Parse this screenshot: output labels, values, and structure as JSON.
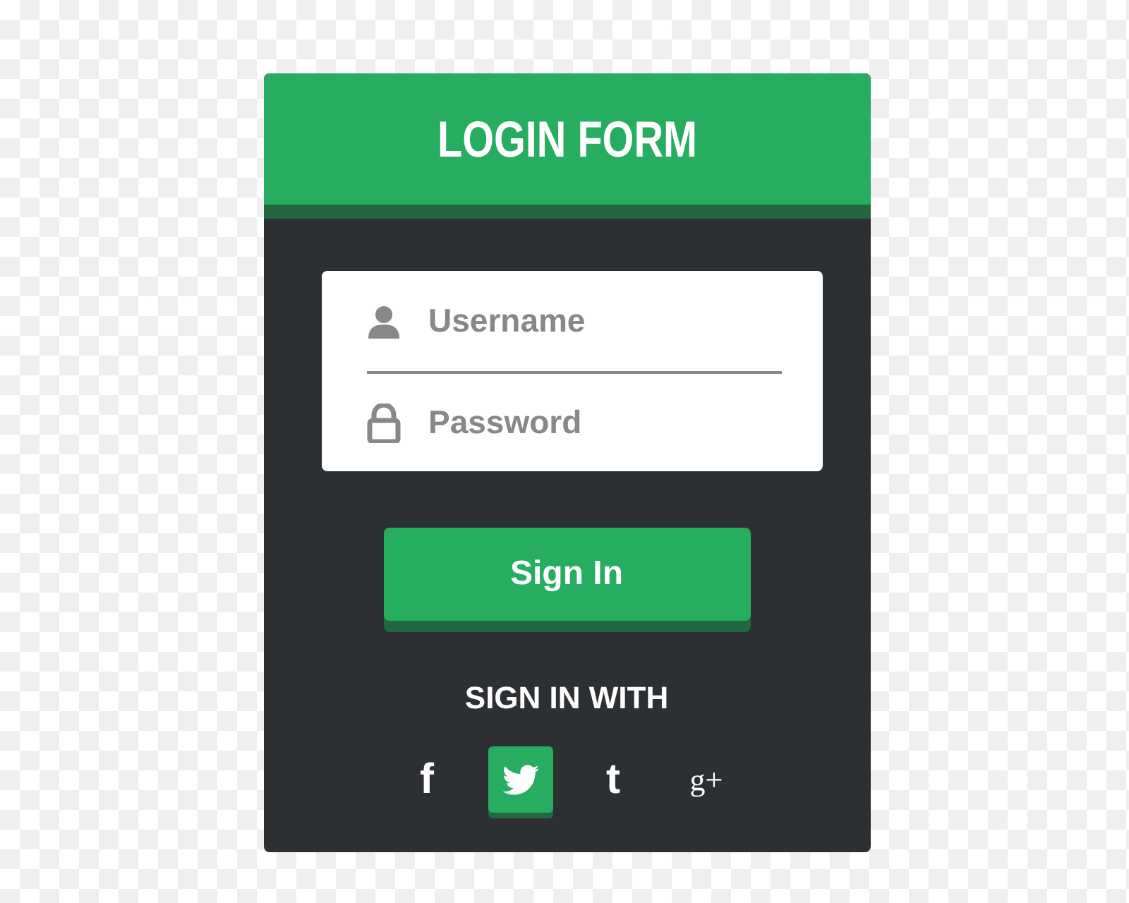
{
  "form": {
    "title": "LOGIN FORM",
    "fields": [
      {
        "kind": "user",
        "placeholder": "Username"
      },
      {
        "kind": "lock",
        "placeholder": "Password"
      }
    ],
    "submit": "Sign In",
    "social_heading": "SIGN IN WITH",
    "social": [
      {
        "glyph": "f",
        "selected": false
      },
      {
        "kind": "bird",
        "selected": true
      },
      {
        "glyph": "t",
        "selected": false
      },
      {
        "glyph": "g+",
        "selected": false
      }
    ]
  }
}
